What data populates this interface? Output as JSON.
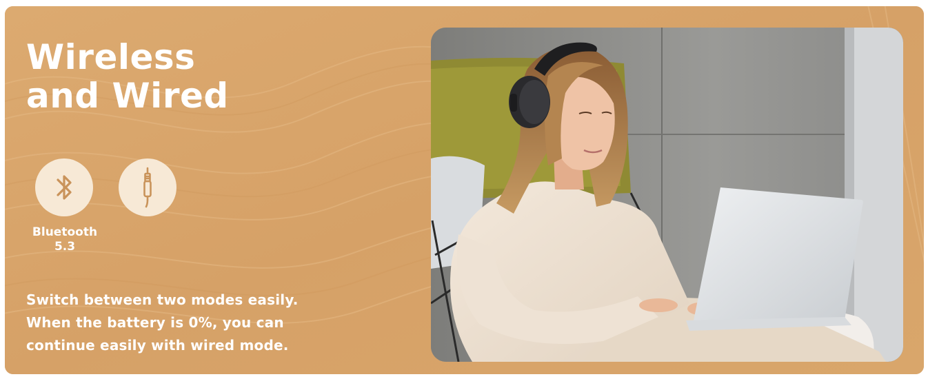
{
  "headline": {
    "line1": "Wireless",
    "line2": "and Wired"
  },
  "modes": [
    {
      "icon": "bluetooth-icon",
      "label_line1": "Bluetooth",
      "label_line2": "5.3"
    },
    {
      "icon": "audio-jack-icon"
    }
  ],
  "description": {
    "line1": "Switch between two modes easily.",
    "line2": "When the battery is 0%, you can",
    "line3": "continue easily with wired mode."
  },
  "colors": {
    "banner_background": "#d8a56a",
    "icon_circle": "#f7e9d6",
    "icon_stroke": "#c9935a",
    "text": "#ffffff"
  }
}
